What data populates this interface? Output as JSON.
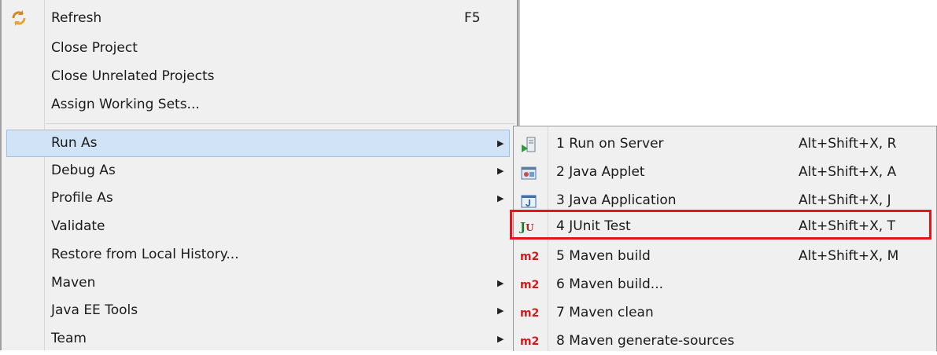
{
  "main_menu": {
    "items": [
      {
        "label": "Refresh",
        "accel": "F5",
        "icon": "refresh-icon"
      },
      {
        "label": "Close Project"
      },
      {
        "label": "Close Unrelated Projects"
      },
      {
        "label": "Assign Working Sets..."
      },
      {
        "label": "Run As",
        "submenu": true,
        "highlighted": true
      },
      {
        "label": "Debug As",
        "submenu": true
      },
      {
        "label": "Profile As",
        "submenu": true
      },
      {
        "label": "Validate"
      },
      {
        "label": "Restore from Local History..."
      },
      {
        "label": "Maven",
        "submenu": true
      },
      {
        "label": "Java EE Tools",
        "submenu": true
      },
      {
        "label": "Team",
        "submenu": true
      }
    ],
    "submenu_arrow": "▶"
  },
  "run_as_submenu": {
    "items": [
      {
        "label": "1 Run on Server",
        "accel": "Alt+Shift+X, R",
        "icon": "run-on-server-icon"
      },
      {
        "label": "2 Java Applet",
        "accel": "Alt+Shift+X, A",
        "icon": "java-applet-icon"
      },
      {
        "label": "3 Java Application",
        "accel": "Alt+Shift+X, J",
        "icon": "java-application-icon"
      },
      {
        "label": "4 JUnit Test",
        "accel": "Alt+Shift+X, T",
        "icon": "junit-icon",
        "icon_text_j": "J",
        "icon_text_u": "U",
        "highlighted": true
      },
      {
        "label": "5 Maven build",
        "accel": "Alt+Shift+X, M",
        "icon": "maven-icon",
        "icon_text": "m2"
      },
      {
        "label": "6 Maven build...",
        "icon": "maven-icon",
        "icon_text": "m2"
      },
      {
        "label": "7 Maven clean",
        "icon": "maven-icon",
        "icon_text": "m2"
      },
      {
        "label": "8 Maven generate-sources",
        "icon": "maven-icon",
        "icon_text": "m2"
      }
    ]
  },
  "colors": {
    "menu_bg": "#f0f0f0",
    "hover_bg": "#d1e4f7",
    "annotation_red": "#e8141b",
    "maven_red": "#d21b1b",
    "junit_green": "#1d7d2a"
  }
}
